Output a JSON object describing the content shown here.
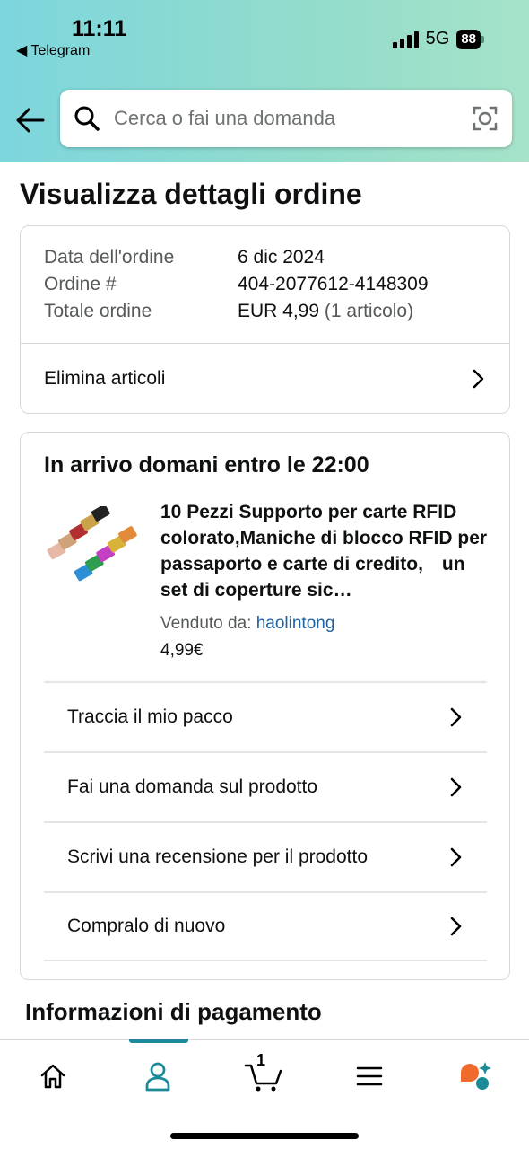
{
  "status_bar": {
    "time": "11:11",
    "back_app": "◀ Telegram",
    "network": "5G",
    "battery": "88"
  },
  "search": {
    "placeholder": "Cerca o fai una domanda"
  },
  "page_title": "Visualizza dettagli ordine",
  "order": {
    "date_label": "Data dell'ordine",
    "date_value": "6 dic 2024",
    "number_label": "Ordine #",
    "number_value": "404-2077612-4148309",
    "total_label": "Totale ordine",
    "total_value": "EUR 4,99",
    "total_sub": "(1 articolo)",
    "delete_label": "Elimina articoli"
  },
  "shipment": {
    "arrival": "In arrivo domani entro le 22:00",
    "product_title": "10 Pezzi Supporto per carte RFID colorato,Maniche di blocco RFID per passaporto e carte di credito,　un set di coperture sic…",
    "seller_label": "Venduto da:",
    "seller_name": "haolintong",
    "price": "4,99€",
    "actions": [
      {
        "label": "Traccia il mio pacco"
      },
      {
        "label": "Fai una domanda sul prodotto"
      },
      {
        "label": "Scrivi una recensione per il prodotto"
      },
      {
        "label": "Compralo di nuovo"
      }
    ]
  },
  "payment_title": "Informazioni di pagamento",
  "tabbar": {
    "cart_count": "1",
    "active_tab": "account",
    "accent_color": "#1a8a99"
  }
}
